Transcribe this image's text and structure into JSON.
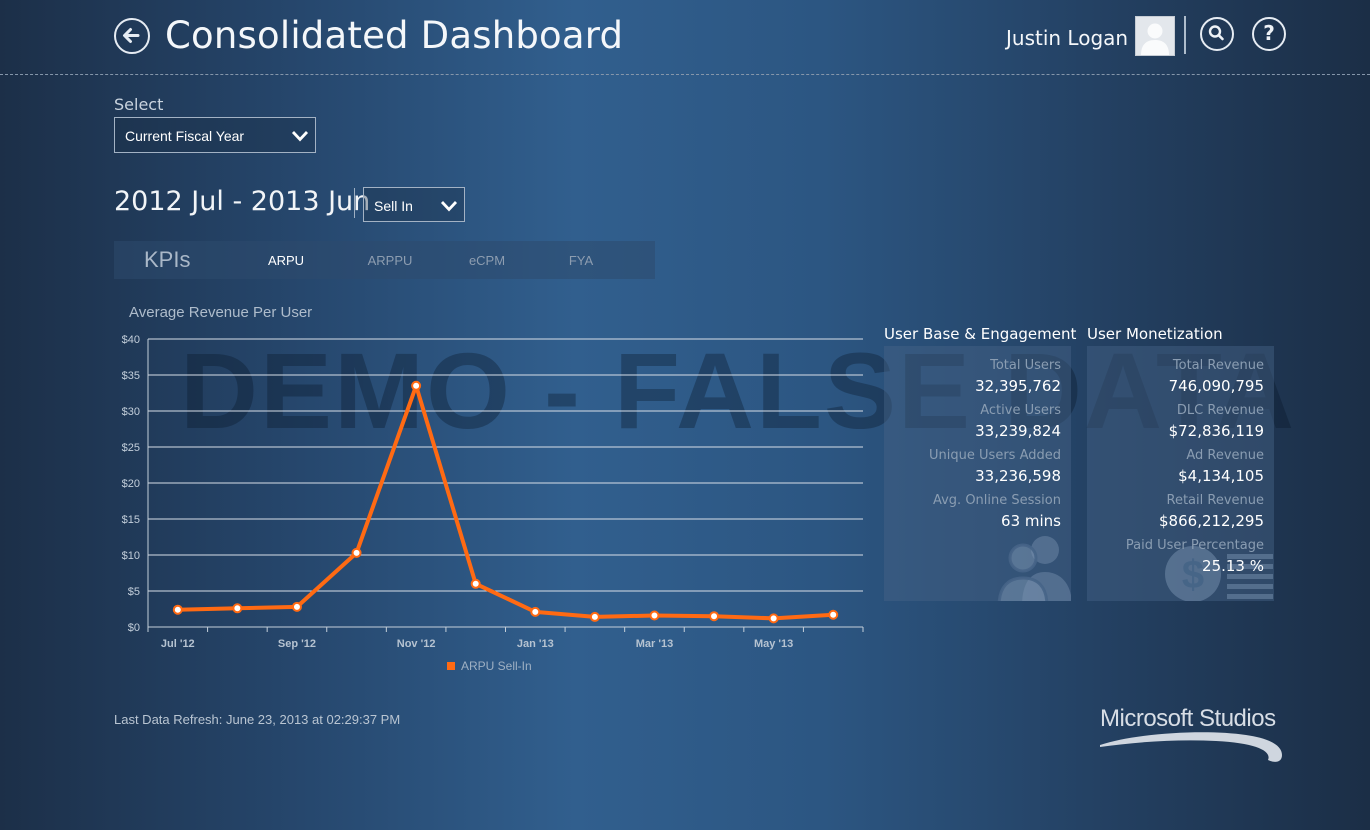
{
  "header": {
    "title": "Consolidated Dashboard",
    "user_name": "Justin Logan",
    "icons": [
      "back-arrow-icon",
      "user-avatar-icon",
      "search-icon",
      "help-icon"
    ]
  },
  "filters": {
    "select_label": "Select",
    "fiscal_value": "Current Fiscal Year",
    "date_range": "2012 Jul - 2013 Jun",
    "sell_value": "Sell In"
  },
  "kpis": {
    "title": "KPIs",
    "tabs": [
      "ARPU",
      "ARPPU",
      "eCPM",
      "FYA"
    ],
    "active": "ARPU"
  },
  "watermark": "DEMO - FALSE DATA",
  "chart_data": {
    "type": "line",
    "title": "Average Revenue Per User",
    "x": [
      "Jul '12",
      "Aug '12",
      "Sep '12",
      "Oct '12",
      "Nov '12",
      "Dec '12",
      "Jan '13",
      "Feb '13",
      "Mar '13",
      "Apr '13",
      "May '13",
      "Jun '13"
    ],
    "x_tick_labels": [
      "Jul '12",
      "Sep '12",
      "Nov '12",
      "Jan '13",
      "Mar '13",
      "May '13"
    ],
    "y_tick_labels": [
      "$0",
      "$5",
      "$10",
      "$15",
      "$20",
      "$25",
      "$30",
      "$35",
      "$40"
    ],
    "ylim": [
      0,
      40
    ],
    "grid": true,
    "legend_position": "bottom",
    "series": [
      {
        "name": "ARPU Sell-In",
        "color": "#ff6a13",
        "values": [
          2.4,
          2.6,
          2.8,
          10.3,
          33.5,
          6.0,
          2.1,
          1.4,
          1.6,
          1.5,
          1.2,
          1.7
        ]
      }
    ]
  },
  "user_base": {
    "title": "User Base & Engagement",
    "stats": [
      {
        "label": "Total Users",
        "value": "32,395,762"
      },
      {
        "label": "Active Users",
        "value": "33,239,824"
      },
      {
        "label": "Unique Users Added",
        "value": "33,236,598"
      },
      {
        "label": "Avg. Online Session",
        "value": "63 mins"
      }
    ]
  },
  "monetization": {
    "title": "User Monetization",
    "stats": [
      {
        "label": "Total Revenue",
        "value": "746,090,795"
      },
      {
        "label": "DLC Revenue",
        "value": "$72,836,119"
      },
      {
        "label": "Ad Revenue",
        "value": "$4,134,105"
      },
      {
        "label": "Retail Revenue",
        "value": "$866,212,295"
      },
      {
        "label": "Paid User Percentage",
        "value": "25.13 %"
      }
    ]
  },
  "footer": {
    "refresh": "Last Data Refresh: June 23, 2013 at 02:29:37 PM",
    "brand": "Microsoft Studios"
  }
}
